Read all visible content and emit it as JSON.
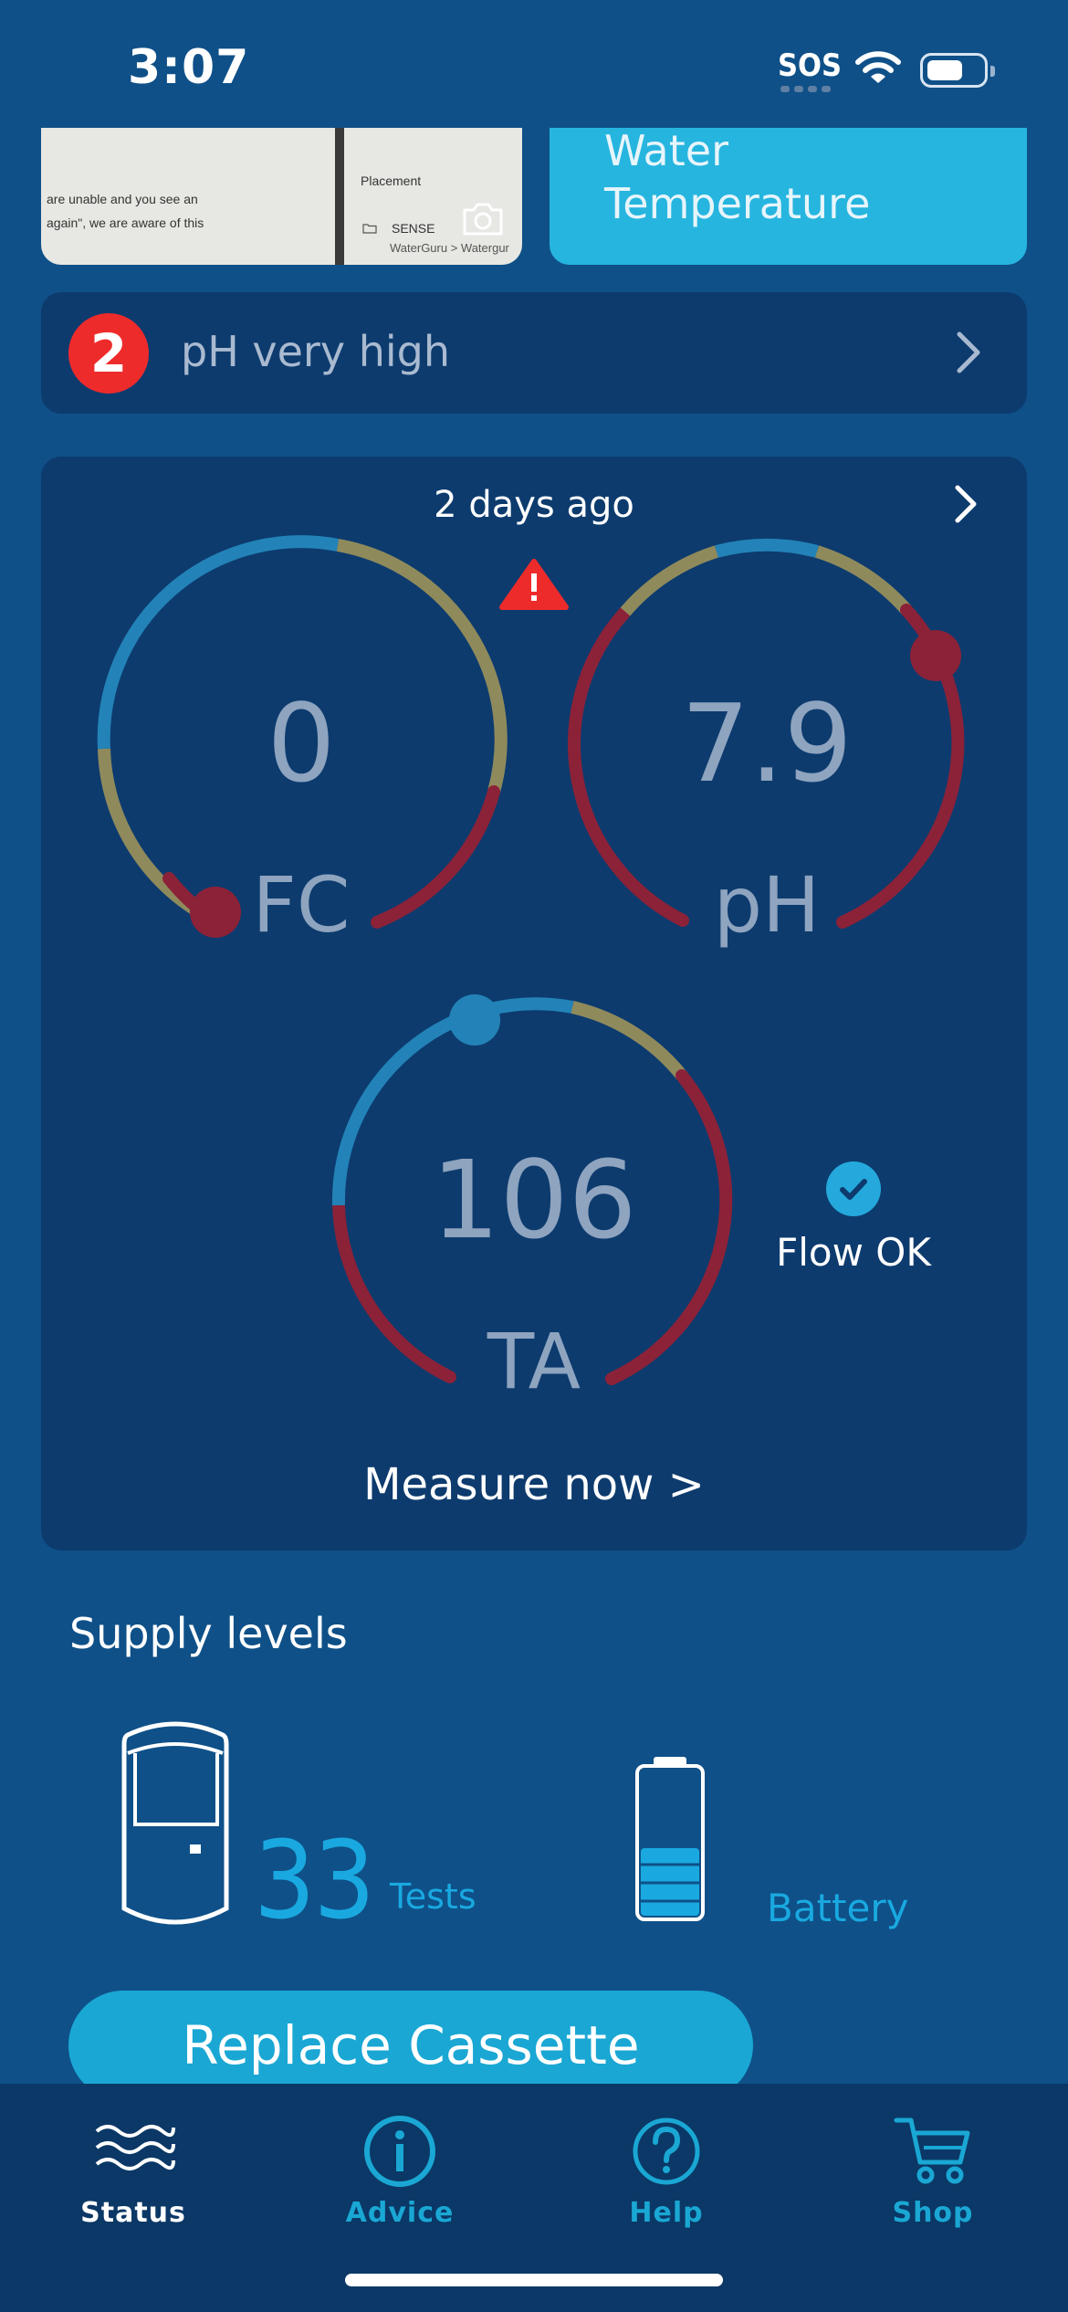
{
  "status_bar": {
    "time": "3:07",
    "sos": "SOS"
  },
  "photo_card": {
    "line1": "are unable and you see an",
    "line2": "again\", we are aware of this",
    "right_title": "Placement",
    "right_folder": "SENSE",
    "right_path": "WaterGuru > Watergur"
  },
  "temp_card": {
    "label": "Water Temperature"
  },
  "alert": {
    "count": "2",
    "text": "pH very high"
  },
  "measurement": {
    "last_update": "2 days ago",
    "gauges": [
      {
        "id": "fc",
        "value": "0",
        "label": "FC",
        "indicator": "low"
      },
      {
        "id": "ph",
        "value": "7.9",
        "label": "pH",
        "indicator": "high"
      },
      {
        "id": "ta",
        "value": "106",
        "label": "TA",
        "indicator": "in-range"
      }
    ],
    "flow_status": "Flow OK",
    "measure_now": "Measure now >"
  },
  "supply": {
    "title": "Supply levels",
    "cassette_tests": "33",
    "tests_label": "Tests",
    "battery_label": "Battery",
    "battery_level": 0.45,
    "replace_button": "Replace Cassette"
  },
  "tabs": [
    {
      "label": "Status",
      "icon": "waves-icon",
      "active": true
    },
    {
      "label": "Advice",
      "icon": "info-icon",
      "active": false
    },
    {
      "label": "Help",
      "icon": "question-icon",
      "active": false
    },
    {
      "label": "Shop",
      "icon": "cart-icon",
      "active": false
    }
  ],
  "colors": {
    "background": "#0f5088",
    "card": "#0d3b6e",
    "accent": "#1aa7d4",
    "gauge_blue": "#2383b8",
    "gauge_olive": "#8f8a5c",
    "gauge_red": "#8b2238",
    "alert_red": "#ee2b2b"
  }
}
